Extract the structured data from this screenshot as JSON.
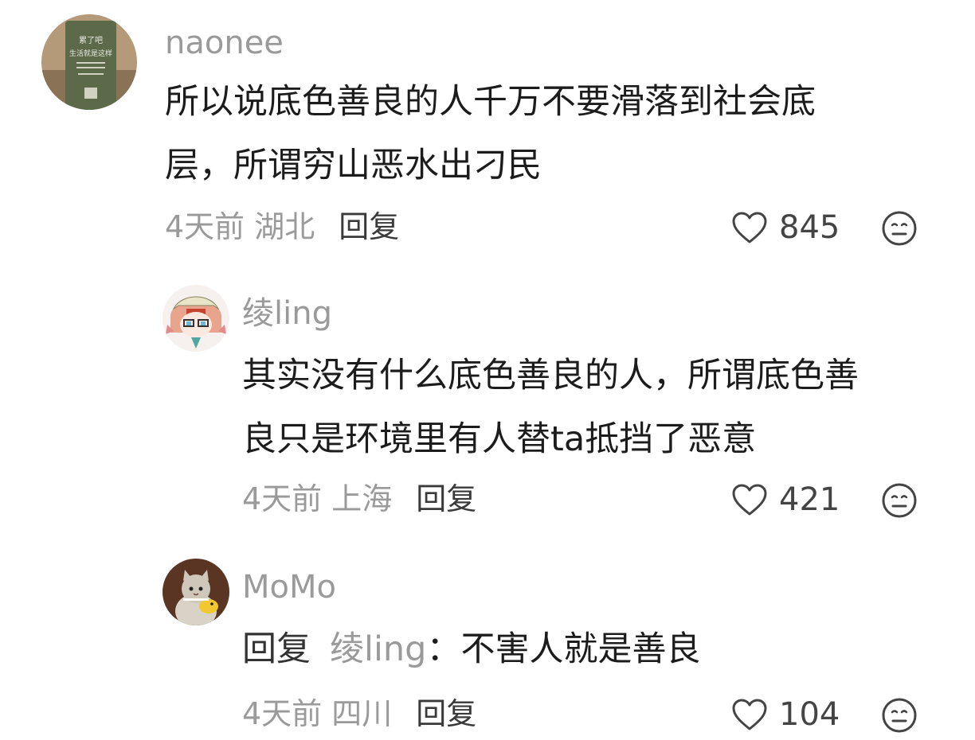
{
  "comments": [
    {
      "username": "naonee",
      "text_line1": "所以说底色善良的人千万不要滑落到社会底",
      "text_line2": "层，所谓穷山恶水出刁民",
      "time": "4天前",
      "location": "湖北",
      "reply_label": "回复",
      "likes": "845",
      "avatar_sign_text1": "累了吧",
      "avatar_sign_text2": "生活就是这样"
    },
    {
      "username": "绫ling",
      "text_line1": "其实没有什么底色善良的人，所谓底色善",
      "text_line2": "良只是环境里有人替ta抵挡了恶意",
      "time": "4天前",
      "location": "上海",
      "reply_label": "回复",
      "likes": "421"
    },
    {
      "username": "MoMo",
      "reply_prefix": "回复",
      "reply_target": "绫ling",
      "reply_colon": "：",
      "text": "不害人就是善良",
      "time": "4天前",
      "location": "四川",
      "reply_label": "回复",
      "likes": "104"
    }
  ],
  "icons": {
    "like": "heart-outline-icon",
    "emoji": "neutral-face-icon"
  }
}
